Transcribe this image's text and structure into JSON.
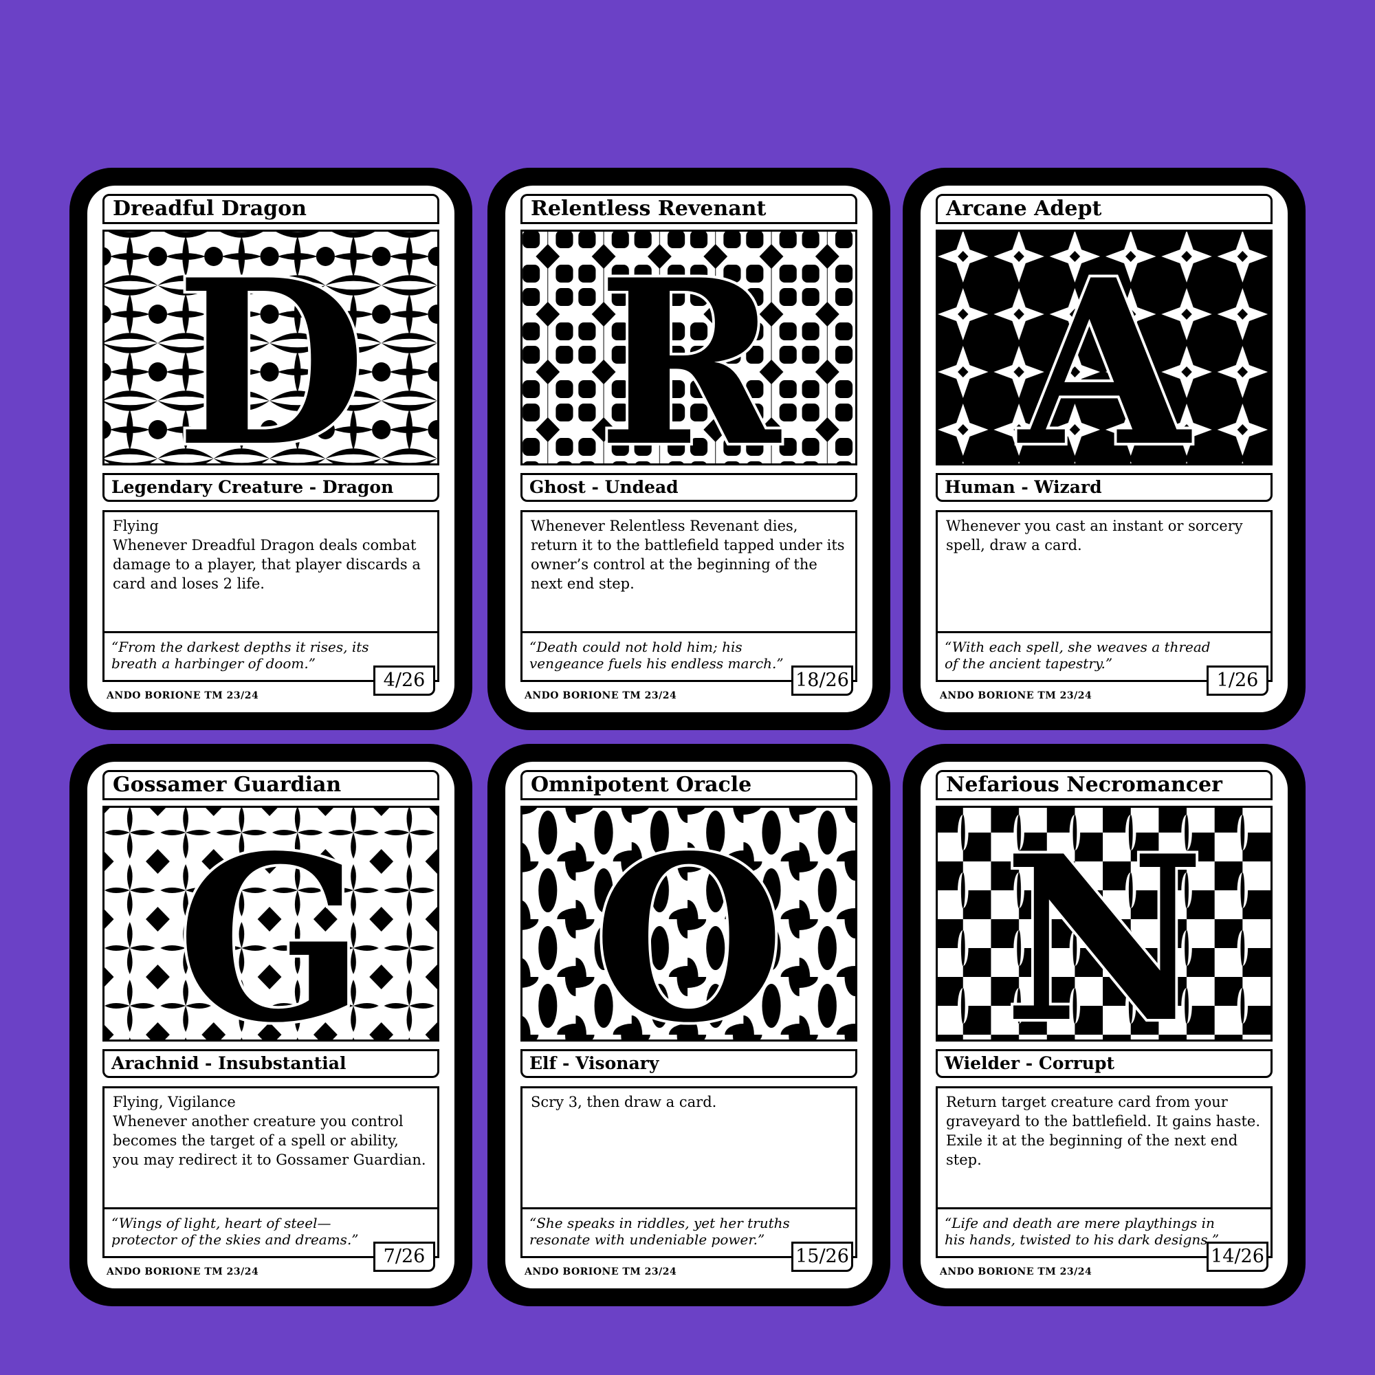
{
  "colors": {
    "background": "#6b41c6",
    "card_frame": "#000000",
    "card_face": "#ffffff"
  },
  "cards": [
    {
      "name": "Dreadful Dragon",
      "letter": "D",
      "type": "Legendary Creature - Dragon",
      "rules": [
        "Flying",
        "Whenever Dreadful Dragon deals combat damage to a player, that player discards a card and loses 2 life."
      ],
      "flavor": "“From the darkest depths it rises, its breath a harbinger of doom.”",
      "number": "4/26",
      "artist": "ANDO BORIONE  TM 23/24",
      "pattern": "petals"
    },
    {
      "name": "Relentless Revenant",
      "letter": "R",
      "type": "Ghost - Undead",
      "rules": [
        "Whenever Relentless Revenant dies, return it to the battlefield tapped under its owner’s control at the beginning of the next end step."
      ],
      "flavor": "“Death could not hold him; his vengeance fuels his endless march.”",
      "number": "18/26",
      "artist": "ANDO BORIONE  TM 23/24",
      "pattern": "blocks"
    },
    {
      "name": "Arcane Adept",
      "letter": "A",
      "type": "Human - Wizard",
      "rules": [
        "Whenever you cast an instant or sorcery spell, draw a card."
      ],
      "flavor": "“With each spell, she weaves a thread of the ancient tapestry.”",
      "number": "1/26",
      "artist": "ANDO BORIONE  TM 23/24",
      "pattern": "stars"
    },
    {
      "name": "Gossamer Guardian",
      "letter": "G",
      "type": "Arachnid - Insubstantial",
      "rules": [
        "Flying, Vigilance",
        "Whenever another creature you control becomes the target of a spell or ability, you may redirect it to Gossamer Guardian."
      ],
      "flavor": "“Wings of light, heart of steel—protector of the skies and dreams.”",
      "number": "7/26",
      "artist": "ANDO BORIONE  TM 23/24",
      "pattern": "flowers"
    },
    {
      "name": "Omnipotent Oracle",
      "letter": "O",
      "type": "Elf - Visonary",
      "rules": [
        "Scry 3, then draw a card."
      ],
      "flavor": "“She speaks in riddles, yet her truths resonate with undeniable power.”",
      "number": "15/26",
      "artist": "ANDO BORIONE  TM 23/24",
      "pattern": "circles"
    },
    {
      "name": "Nefarious Necromancer",
      "letter": "N",
      "type": "Wielder - Corrupt",
      "rules": [
        "Return target creature card from your graveyard to the battlefield. It gains haste. Exile it at the beginning of the next end step."
      ],
      "flavor": "“Life and death are mere playthings in his hands, twisted to his dark designs.”",
      "number": "14/26",
      "artist": "ANDO BORIONE  TM 23/24",
      "pattern": "checks"
    }
  ]
}
